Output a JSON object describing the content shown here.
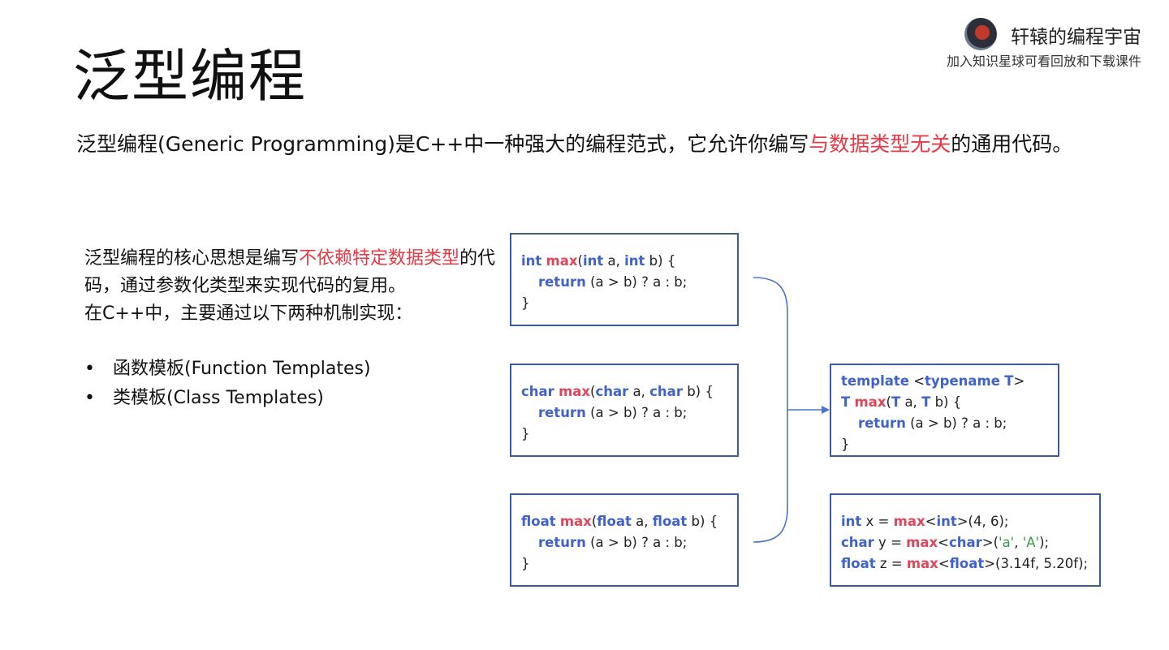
{
  "title": "泛型编程",
  "brand": {
    "name": "轩辕的编程宇宙",
    "sub": "加入知识星球可看回放和下载课件"
  },
  "intro": {
    "prefix": "泛型编程(Generic Programming)是C++中一种强大的编程范式，它允许你编写",
    "highlight": "与数据类型无关",
    "suffix": "的通用代码。"
  },
  "core": {
    "p1_prefix": "泛型编程的核心思想是编写",
    "p1_highlight": "不依赖特定数据类型",
    "p1_suffix": "的代码，通过参数化类型来实现代码的复用。",
    "p2": "在C++中，主要通过以下两种机制实现："
  },
  "bullets": [
    {
      "dot": "•",
      "text": "函数模板(Function Templates)"
    },
    {
      "dot": "•",
      "text": "类模板(Class Templates)"
    }
  ],
  "code_int": {
    "l1": {
      "t1": "int",
      "fn": "max",
      "p": "(",
      "t2": "int",
      "a": " a, ",
      "t3": "int",
      "b": " b) {"
    },
    "l2": {
      "ind": "    ",
      "kw": "return",
      "rest": " (a > b) ? a : b;"
    },
    "l3": "}"
  },
  "code_char": {
    "l1": {
      "t1": "char",
      "fn": "max",
      "p": "(",
      "t2": "char",
      "a": " a, ",
      "t3": "char",
      "b": " b) {"
    },
    "l2": {
      "ind": "    ",
      "kw": "return",
      "rest": " (a > b) ? a : b;"
    },
    "l3": "}"
  },
  "code_float": {
    "l1": {
      "t1": "float",
      "fn": "max",
      "p": "(",
      "t2": "float",
      "a": " a, ",
      "t3": "float",
      "b": " b) {"
    },
    "l2": {
      "ind": "    ",
      "kw": "return",
      "rest": " (a > b) ? a : b;"
    },
    "l3": "}"
  },
  "code_template": {
    "l1": {
      "kw": "template",
      "lt": " <",
      "kw2": "typename",
      "sp": " ",
      "t": "T",
      "gt": ">"
    },
    "l2": {
      "t1": "T",
      "sp": " ",
      "fn": "max",
      "p": "(",
      "t2": "T",
      "a": " a, ",
      "t3": "T",
      "b": " b) {"
    },
    "l3": {
      "ind": "    ",
      "kw": "return",
      "rest": " (a > b) ? a : b;"
    },
    "l4": "}"
  },
  "code_usage": {
    "l1": {
      "t": "int",
      "v": " x = ",
      "fn": "max",
      "lt": "<",
      "t2": "int",
      "rest": ">(4, 6);"
    },
    "l2": {
      "t": "char",
      "v": " y = ",
      "fn": "max",
      "lt": "<",
      "t2": "char",
      "open": ">(",
      "s1": "'a'",
      "comma": ", ",
      "s2": "'A'",
      "close": ");"
    },
    "l3": {
      "t": "float",
      "v": " z = ",
      "fn": "max",
      "lt": "<",
      "t2": "float",
      "rest": ">(3.14f, 5.20f);"
    }
  },
  "colors": {
    "keyword": "#3f63c9",
    "function": "#e0465a",
    "highlight": "#e53945",
    "string": "#3a9a4a",
    "border": "#3d5a99"
  }
}
